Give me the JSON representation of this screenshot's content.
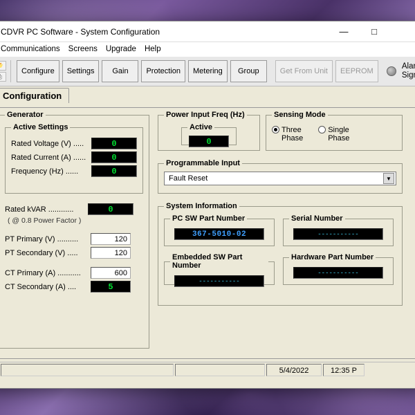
{
  "window": {
    "title": "CDVR PC Software - System Configuration"
  },
  "menu": {
    "communications": "Communications",
    "screens": "Screens",
    "upgrade": "Upgrade",
    "help": "Help"
  },
  "toolbar": {
    "configure": "Configure",
    "settings": "Settings",
    "gain": "Gain",
    "protection": "Protection",
    "metering": "Metering",
    "group": "Group",
    "get_from_unit": "Get From Unit",
    "eeprom": "EEPROM",
    "alarm_label_l1": "Alar",
    "alarm_label_l2": "Sign"
  },
  "tab": {
    "title": "Configuration"
  },
  "generator": {
    "legend": "Generator",
    "active_legend": "Active Settings",
    "rated_voltage_label": "Rated Voltage (V) .....",
    "rated_voltage": "0",
    "rated_current_label": "Rated Current (A) ......",
    "rated_current": "0",
    "frequency_label": "Frequency (Hz) ......",
    "frequency": "0",
    "rated_kvar_label": "Rated kVAR ............",
    "rated_kvar": "0",
    "pf_note": "( @ 0.8 Power Factor )",
    "pt_primary_label": "PT Primary (V) ..........",
    "pt_primary": "120",
    "pt_secondary_label": "PT Secondary (V) .....",
    "pt_secondary": "120",
    "ct_primary_label": "CT Primary (A) ...........",
    "ct_primary": "600",
    "ct_secondary_label": "CT Secondary (A) ....",
    "ct_secondary": "5"
  },
  "power_input": {
    "legend": "Power Input Freq (Hz)",
    "active_legend": "Active",
    "value": "0"
  },
  "sensing": {
    "legend": "Sensing Mode",
    "three_phase": "Three Phase",
    "single_phase": "Single Phase",
    "selected": "three"
  },
  "prog_input": {
    "legend": "Programmable Input",
    "option": "Fault Reset"
  },
  "sysinfo": {
    "legend": "System Information",
    "pc_sw_legend": "PC SW Part Number",
    "pc_sw": "367-5010-02",
    "serial_legend": "Serial Number",
    "serial": "-----------",
    "emb_sw_legend": "Embedded SW Part Number",
    "emb_sw": "-----------",
    "hw_legend": "Hardware Part Number",
    "hw": "-----------"
  },
  "status": {
    "date": "5/4/2022",
    "time": "12:35 P"
  }
}
